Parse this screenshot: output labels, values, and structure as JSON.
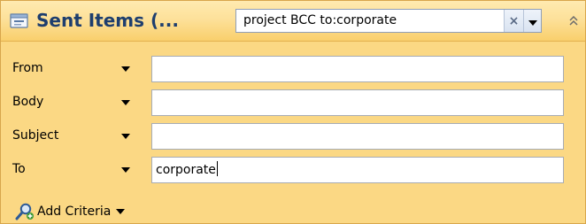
{
  "header": {
    "folder_icon": "sent-items-folder-icon",
    "title": "Sent Items (...",
    "search": {
      "value": "project BCC to:corporate",
      "clear_symbol": "×",
      "clear_icon": "close-icon",
      "dropdown_icon": "chevron-down-icon",
      "collapse_icon": "double-chevron-up-icon"
    }
  },
  "criteria": {
    "rows": [
      {
        "label": "From",
        "value": ""
      },
      {
        "label": "Body",
        "value": ""
      },
      {
        "label": "Subject",
        "value": ""
      },
      {
        "label": "To",
        "value": "corporate"
      }
    ],
    "add_criteria": {
      "label": "Add Criteria",
      "icon": "add-criteria-icon"
    }
  },
  "colors": {
    "accent_blue": "#1e3e6e",
    "panel_background": "#fbd884",
    "header_gradient_top": "#ffeab0",
    "header_gradient_bottom": "#f9cf6c"
  }
}
